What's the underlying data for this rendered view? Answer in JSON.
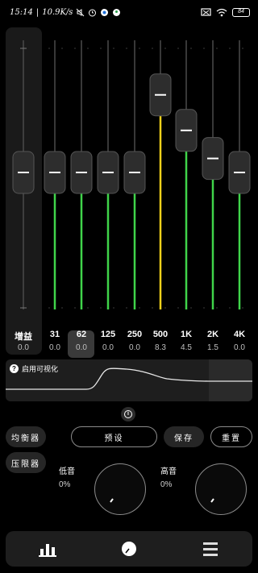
{
  "status_bar": {
    "time": "15:14",
    "speed": "10.9K/s",
    "icons": [
      "mute-icon",
      "alarm-icon",
      "browser-icon",
      "app-icon",
      "screen-cast-icon",
      "wifi-icon",
      "battery-icon"
    ],
    "battery": "84"
  },
  "equalizer": {
    "gain": {
      "label": "增益",
      "value": "0.0",
      "level": 0.0
    },
    "bands": [
      {
        "label": "31",
        "value": "0.0",
        "level": 0.0
      },
      {
        "label": "62",
        "value": "0.0",
        "level": 0.0,
        "selected": true
      },
      {
        "label": "125",
        "value": "0.0",
        "level": 0.0
      },
      {
        "label": "250",
        "value": "0.0",
        "level": 0.0
      },
      {
        "label": "500",
        "value": "8.3",
        "level": 8.3,
        "color": "#f2d11b"
      },
      {
        "label": "1K",
        "value": "4.5",
        "level": 4.5
      },
      {
        "label": "2K",
        "value": "1.5",
        "level": 1.5
      },
      {
        "label": "4K",
        "value": "0.0",
        "level": 0.0
      }
    ],
    "range": [
      -12,
      12
    ],
    "colors": {
      "active": "#3fd44a",
      "highlight": "#f2d11b"
    }
  },
  "visualizer": {
    "label": "启用可视化",
    "icon": "help-icon"
  },
  "buttons": {
    "equalizer": "均衡器",
    "limiter": "压限器",
    "presets": "预设",
    "save": "保存",
    "reset": "重置"
  },
  "knobs": {
    "bass": {
      "label": "低音",
      "value": "0%"
    },
    "treble": {
      "label": "高音",
      "value": "0%"
    }
  },
  "nav": {
    "items": [
      "equalizer-bars-icon",
      "knob-icon",
      "menu-icon"
    ]
  }
}
